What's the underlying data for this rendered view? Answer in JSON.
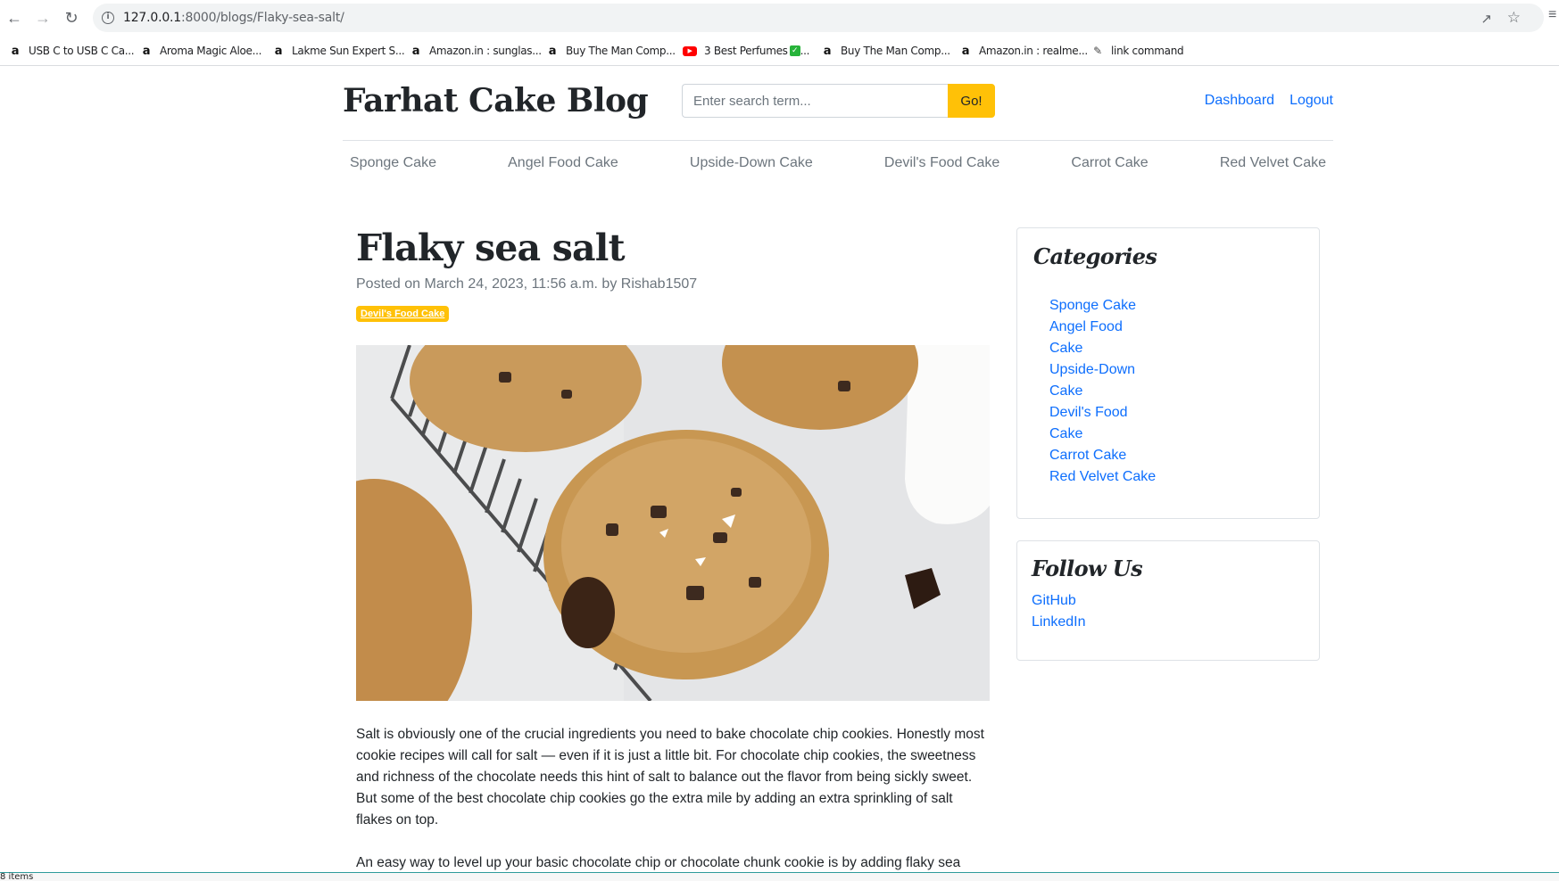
{
  "browser": {
    "url_host": "127.0.0.1",
    "url_path": ":8000/blogs/Flaky-sea-salt/",
    "bookmarks": [
      {
        "icon": "amazon-icon",
        "label": "USB C to USB C Ca..."
      },
      {
        "icon": "amazon-icon",
        "label": "Aroma Magic Aloe..."
      },
      {
        "icon": "amazon-icon",
        "label": "Lakme Sun Expert S..."
      },
      {
        "icon": "amazon-icon",
        "label": "Amazon.in : sunglas..."
      },
      {
        "icon": "amazon-icon",
        "label": "Buy The Man Comp..."
      },
      {
        "icon": "youtube-icon",
        "label": "3 Best Perfumes"
      },
      {
        "icon": "amazon-icon",
        "label": "Buy The Man Comp..."
      },
      {
        "icon": "amazon-icon",
        "label": "Amazon.in : realme..."
      },
      {
        "icon": "link-icon",
        "label": "link command"
      }
    ],
    "status_text": "8 items"
  },
  "header": {
    "site_title": "Farhat Cake Blog",
    "search_placeholder": "Enter search term...",
    "search_button": "Go!",
    "links": {
      "dashboard": "Dashboard",
      "logout": "Logout"
    }
  },
  "category_nav": [
    "Sponge Cake",
    "Angel Food Cake",
    "Upside-Down Cake",
    "Devil's Food Cake",
    "Carrot Cake",
    "Red Velvet Cake"
  ],
  "post": {
    "title": "Flaky sea salt",
    "meta": "Posted on March 24, 2023, 11:56 a.m. by Rishab1507",
    "badge": "Devil's Food Cake",
    "paragraphs": [
      "Salt is obviously one of the crucial ingredients you need to bake chocolate chip cookies. Honestly most cookie recipes will call for salt — even if it is just a little bit. For chocolate chip cookies, the sweetness and richness of the chocolate needs this hint of salt to balance out the flavor from being sickly sweet. But some of the best chocolate chip cookies go the extra mile by adding an extra sprinkling of salt flakes on top.",
      "An easy way to level up your basic chocolate chip or chocolate chunk cookie is by adding flaky sea"
    ]
  },
  "sidebar": {
    "categories_title": "Categories",
    "categories": [
      "Sponge Cake",
      "Angel Food Cake",
      "Upside-Down Cake",
      "Devil's Food Cake",
      "Carrot Cake",
      "Red Velvet Cake"
    ],
    "follow_title": "Follow Us",
    "follow_links": [
      "GitHub",
      "LinkedIn"
    ]
  },
  "colors": {
    "accent_yellow": "#ffc107",
    "link_blue": "#0d6efd",
    "muted_gray": "#6c757d"
  }
}
